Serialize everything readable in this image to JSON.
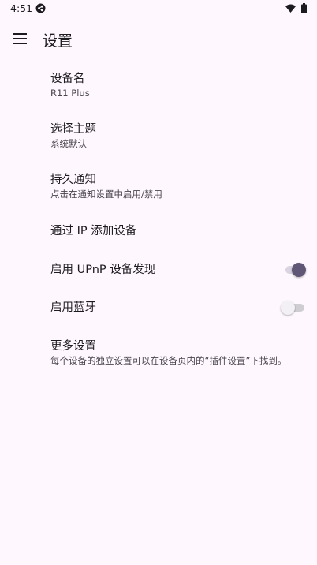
{
  "status_bar": {
    "time": "4:51",
    "icons": [
      "app-notification-icon",
      "wifi-icon",
      "battery-icon"
    ]
  },
  "app_bar": {
    "menu_icon": "hamburger-menu-icon",
    "title": "设置"
  },
  "settings": [
    {
      "id": "device-name",
      "title": "设备名",
      "summary": "R11 Plus"
    },
    {
      "id": "theme",
      "title": "选择主题",
      "summary": "系统默认"
    },
    {
      "id": "persistent-notification",
      "title": "持久通知",
      "summary": "点击在通知设置中启用/禁用"
    },
    {
      "id": "add-device-by-ip",
      "title": "通过 IP 添加设备"
    },
    {
      "id": "upnp-discovery",
      "title": "启用 UPnP 设备发现",
      "switch_on": true
    },
    {
      "id": "bluetooth",
      "title": "启用蓝牙",
      "switch_on": false
    },
    {
      "id": "more-settings",
      "title": "更多设置",
      "summary": "每个设备的独立设置可以在设备页内的“插件设置”下找到。"
    }
  ],
  "colors": {
    "background": "#FFF7FE",
    "text_primary": "#1C1B1F",
    "text_secondary": "#49454F",
    "switch_on_thumb": "#5F5775",
    "switch_on_track": "#D9D3E2",
    "switch_off_thumb": "#F2F0F4",
    "switch_off_track": "#CFCDD2"
  }
}
